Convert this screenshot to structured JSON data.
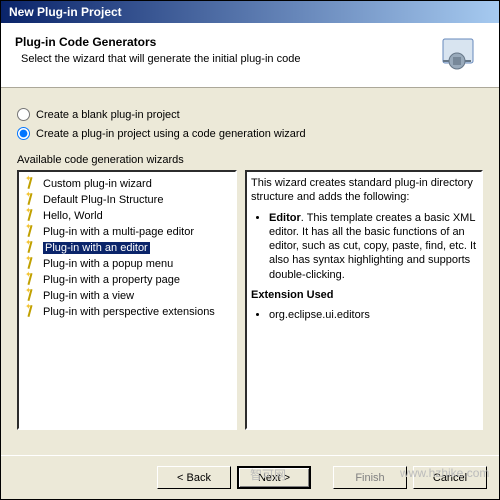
{
  "titlebar": "New Plug-in Project",
  "header": {
    "title": "Plug-in Code Generators",
    "desc": "Select the wizard that will generate the initial plug-in code"
  },
  "radios": {
    "blank": "Create a blank plug-in project",
    "wizard": "Create a plug-in project using a code generation wizard"
  },
  "avail_label": "Available code generation wizards",
  "wizards": [
    "Custom plug-in wizard",
    "Default Plug-In Structure",
    "Hello, World",
    "Plug-in with a multi-page editor",
    "Plug-in with an editor",
    "Plug-in with a popup menu",
    "Plug-in with a property page",
    "Plug-in with a view",
    "Plug-in with perspective extensions"
  ],
  "selected_index": 4,
  "desc": {
    "intro": "This wizard creates standard plug-in directory structure and adds the following:",
    "bullet_label": "Editor",
    "bullet_text": ". This template creates a basic XML editor.  It has all the basic functions of an editor, such as cut, copy, paste, find, etc.  It also has syntax highlighting and supports double-clicking.",
    "ext_header": "Extension Used",
    "ext_item": "org.eclipse.ui.editors"
  },
  "buttons": {
    "back": "< Back",
    "next": "Next >",
    "finish": "Finish",
    "cancel": "Cancel"
  },
  "watermarks": {
    "w1": "智可网",
    "w2": "www.hzhike.com"
  }
}
